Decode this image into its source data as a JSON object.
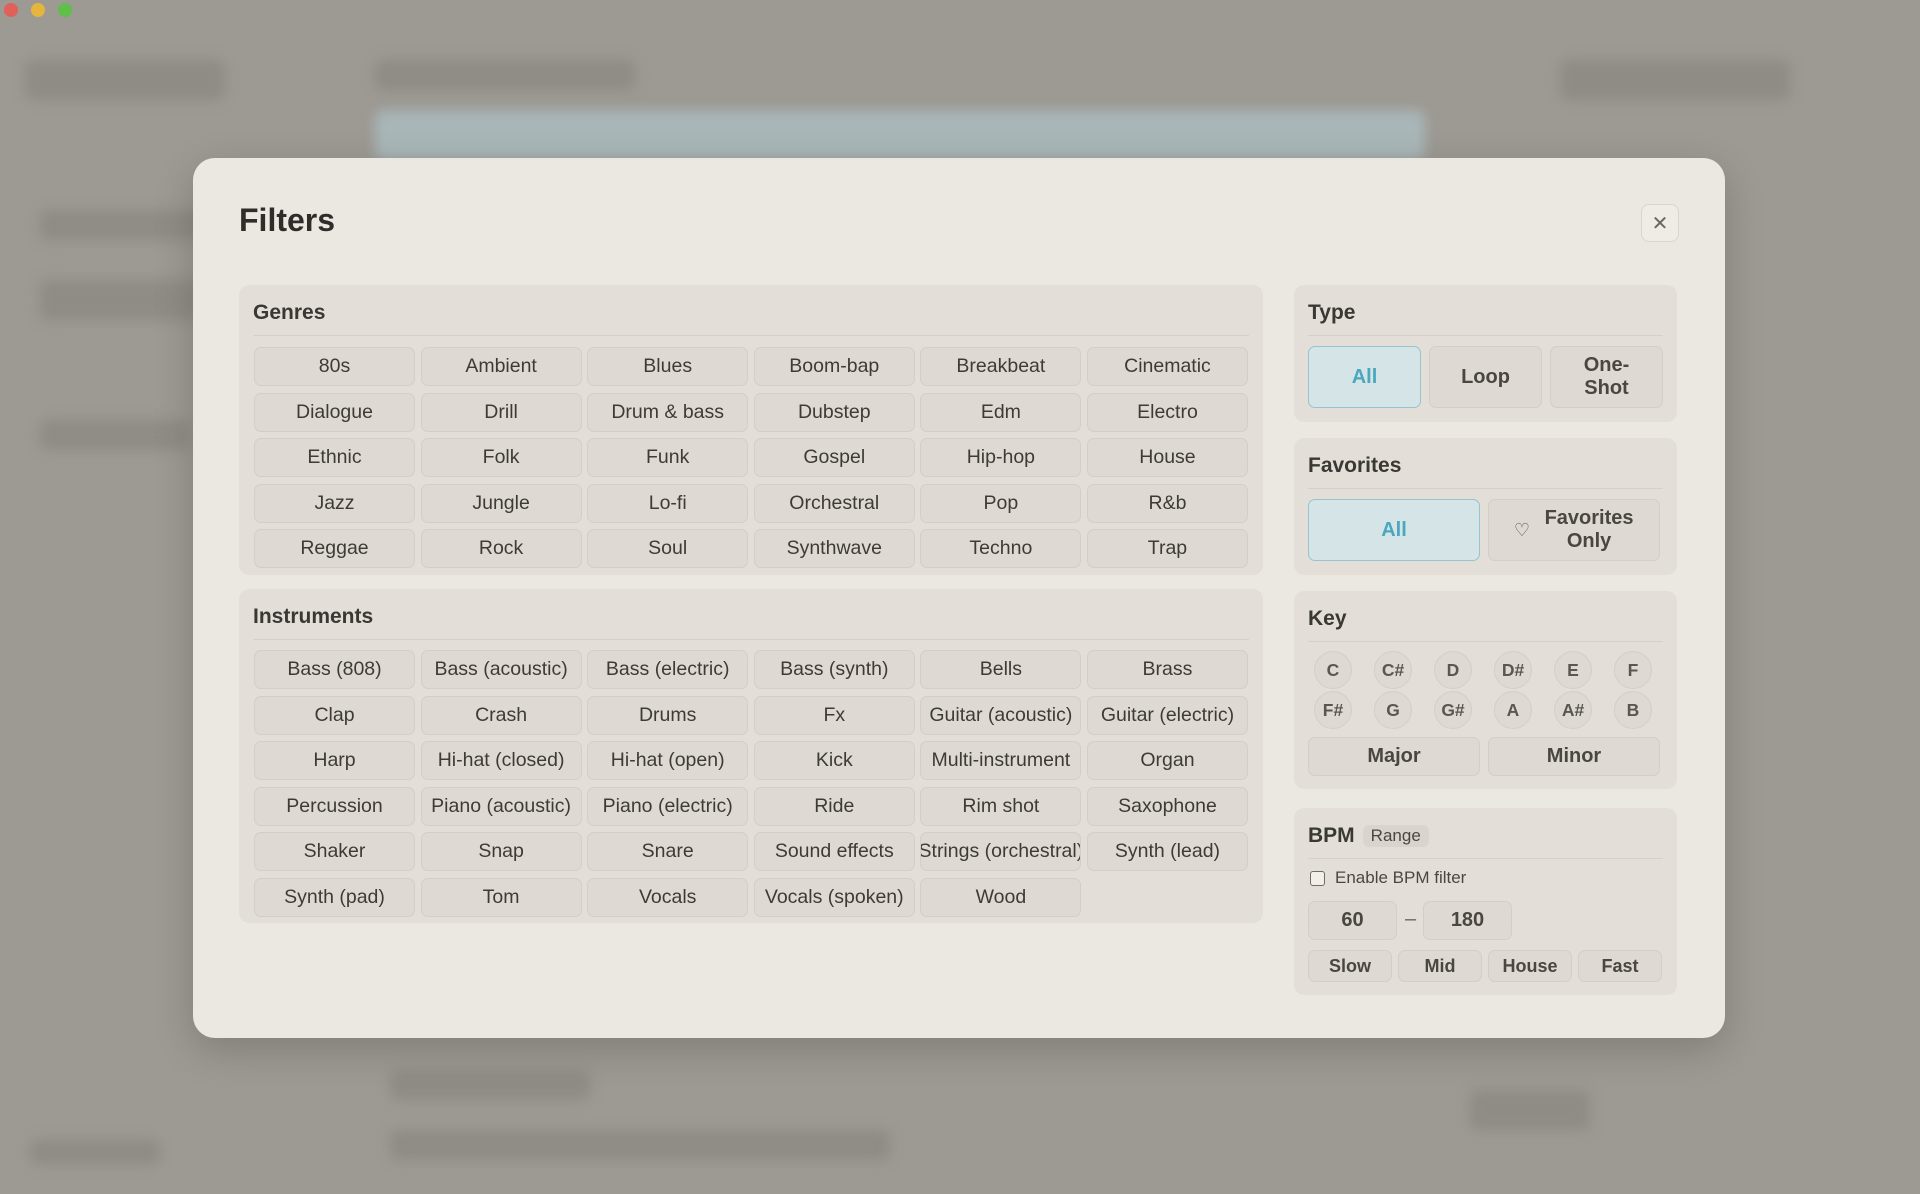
{
  "window": {
    "traffic_lights": [
      "close",
      "minimize",
      "zoom"
    ]
  },
  "modal": {
    "title": "Filters",
    "close_icon": "close-icon"
  },
  "genres": {
    "title": "Genres",
    "items": [
      "80s",
      "Ambient",
      "Blues",
      "Boom-bap",
      "Breakbeat",
      "Cinematic",
      "Dialogue",
      "Drill",
      "Drum & bass",
      "Dubstep",
      "Edm",
      "Electro",
      "Ethnic",
      "Folk",
      "Funk",
      "Gospel",
      "Hip-hop",
      "House",
      "Jazz",
      "Jungle",
      "Lo-fi",
      "Orchestral",
      "Pop",
      "R&b",
      "Reggae",
      "Rock",
      "Soul",
      "Synthwave",
      "Techno",
      "Trap"
    ]
  },
  "instruments": {
    "title": "Instruments",
    "items": [
      "Bass (808)",
      "Bass (acoustic)",
      "Bass (electric)",
      "Bass (synth)",
      "Bells",
      "Brass",
      "Clap",
      "Crash",
      "Drums",
      "Fx",
      "Guitar (acoustic)",
      "Guitar (electric)",
      "Harp",
      "Hi-hat (closed)",
      "Hi-hat (open)",
      "Kick",
      "Multi-instrument",
      "Organ",
      "Percussion",
      "Piano (acoustic)",
      "Piano (electric)",
      "Ride",
      "Rim shot",
      "Saxophone",
      "Shaker",
      "Snap",
      "Snare",
      "Sound effects",
      "Strings (orchestral)",
      "Synth (lead)",
      "Synth (pad)",
      "Tom",
      "Vocals",
      "Vocals (spoken)",
      "Wood"
    ]
  },
  "type": {
    "title": "Type",
    "options": [
      "All",
      "Loop",
      "One-\nShot"
    ],
    "selected": "All"
  },
  "favorites": {
    "title": "Favorites",
    "all": "All",
    "only": "Favorites Only",
    "icon": "heart-icon",
    "selected": "All"
  },
  "key": {
    "title": "Key",
    "row1": [
      "C",
      "C#",
      "D",
      "D#",
      "E",
      "F"
    ],
    "row2": [
      "F#",
      "G",
      "G#",
      "A",
      "A#",
      "B"
    ],
    "major": "Major",
    "minor": "Minor"
  },
  "bpm": {
    "title": "BPM",
    "badge": "Range",
    "enable_label": "Enable BPM filter",
    "enabled": false,
    "min": "60",
    "max": "180",
    "separator": "–",
    "presets": [
      "Slow",
      "Mid",
      "House",
      "Fast"
    ]
  },
  "colors": {
    "accent": "#4aa7bd",
    "accent_bg": "#d4e4e7"
  }
}
